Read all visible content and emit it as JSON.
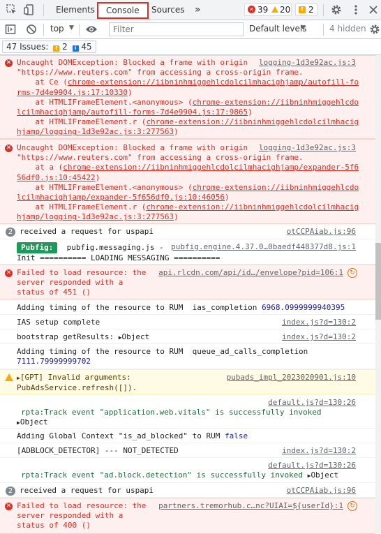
{
  "tabs": {
    "elements": "Elements",
    "console": "Console",
    "sources": "Sources",
    "more": "»"
  },
  "counts": {
    "errors": "39",
    "warnings": "20",
    "issues": "2"
  },
  "toolbar": {
    "context": "top",
    "filter_placeholder": "Filter",
    "levels": "Default levels",
    "hidden": "4 hidden"
  },
  "issues_bar": {
    "label": "47 Issues:",
    "warn_count": "2",
    "info_count": "45"
  },
  "log": {
    "m1": {
      "src": "logging-1d3e92ac.js:3",
      "l1": "Uncaught DOMException: Blocked a frame with origin",
      "l2": "\"https://www.reuters.com\" from accessing a cross-origin frame.",
      "l3a": "    at Ce (",
      "l3b": "chrome-extension://iibninhmiggehlcdolcilmhacighjamp/autofill-fo",
      "l4": "rms-7d4e9904.js:17:10330",
      "l4c": ")",
      "l5a": "    at HTMLIFrameElement.<anonymous> (",
      "l5b": "chrome-extension://iibninhmiggehlcdo",
      "l6": "lcilmhacighjamp/autofill-forms-7d4e9904.js:17:9865",
      "l6c": ")",
      "l7a": "    at HTMLIFrameElement.r (",
      "l7b": "chrome-extension://iibninhmiggehlcdolcilmhacig",
      "l8": "hjamp/logging-1d3e92ac.js:3:277563",
      "l8c": ")"
    },
    "m2": {
      "src": "logging-1d3e92ac.js:3",
      "l1": "Uncaught DOMException: Blocked a frame with origin",
      "l2": "\"https://www.reuters.com\" from accessing a cross-origin frame.",
      "l3a": "    at a (",
      "l3b": "chrome-extension://iibninhmiggehlcdolcilmhacighjamp/expander-5f6",
      "l4": "56df0.js:10:45422",
      "l4c": ")",
      "l5a": "    at HTMLIFrameElement.<anonymous> (",
      "l5b": "chrome-extension://iibninhmiggehlcdo",
      "l6": "lcilmhacighjamp/expander-5f656df0.js:10:46056",
      "l6c": ")",
      "l7a": "    at HTMLIFrameElement.r (",
      "l7b": "chrome-extension://iibninhmiggehlcdolcilmhacig",
      "l8": "hjamp/logging-1d3e92ac.js:3:277563",
      "l8c": ")"
    },
    "m3": {
      "count": "2",
      "text": "received a request for uspapi",
      "src": "otCCPAiab.js:96"
    },
    "m4": {
      "badge": "Pubfig:",
      "text": "pubfig.messaging.js -",
      "src": "pubfig.engine.4.37.0…0baedf448377d8.js:1",
      "l2": "Init ========== LOADING MESSAGING =========="
    },
    "m5": {
      "l1": "Failed to load resource: the",
      "l2": "server responded with a",
      "l3": "status of 451 ()",
      "src": "api.rlcdn.com/api/id…/envelope?pid=106:1"
    },
    "m6": {
      "text": "Adding timing of the resource to RUM  ias_completion",
      "value": "6968.0999999940395"
    },
    "m7": {
      "text": "IAS setup complete",
      "src": "index.js?d=130:2"
    },
    "m8": {
      "text": "bootstrap getResults:",
      "obj": "Object",
      "src": "index.js?d=130:2"
    },
    "m9": {
      "text": "Adding timing of the resource to RUM  queue_ad_calls_completion",
      "value": "7111.79999999702"
    },
    "m10": {
      "l1": "[GPT] Invalid arguments:",
      "l2": "PubAdsService.refresh([]).",
      "src": "pubads_impl_2023020901.js:10"
    },
    "m11": {
      "src": "default.js?d=130:26",
      "l1": "rpta:Track event \"application.web.vitals\" is successfully invoked",
      "obj": "Object"
    },
    "m12": {
      "text": "Adding Global Context \"is_ad_blocked\" to RUM",
      "value": "false"
    },
    "m13": {
      "text": "[ADBLOCK_DETECTOR] --- NOT_DETECTED",
      "src": "index.js?d=130:2"
    },
    "m14": {
      "src": "default.js?d=130:26",
      "l1": "rpta:Track event \"ad.block.detection\" is successfully invoked",
      "obj": "Object"
    },
    "m15": {
      "count": "2",
      "text": "received a request for uspapi",
      "src": "otCCPAiab.js:96"
    },
    "m16": {
      "l1": "Failed to load resource: the",
      "l2": "server responded with a",
      "l3": "status of 400 ()",
      "src": "partners.tremorhub.c…nc?UIAI=${userId}:1"
    }
  }
}
